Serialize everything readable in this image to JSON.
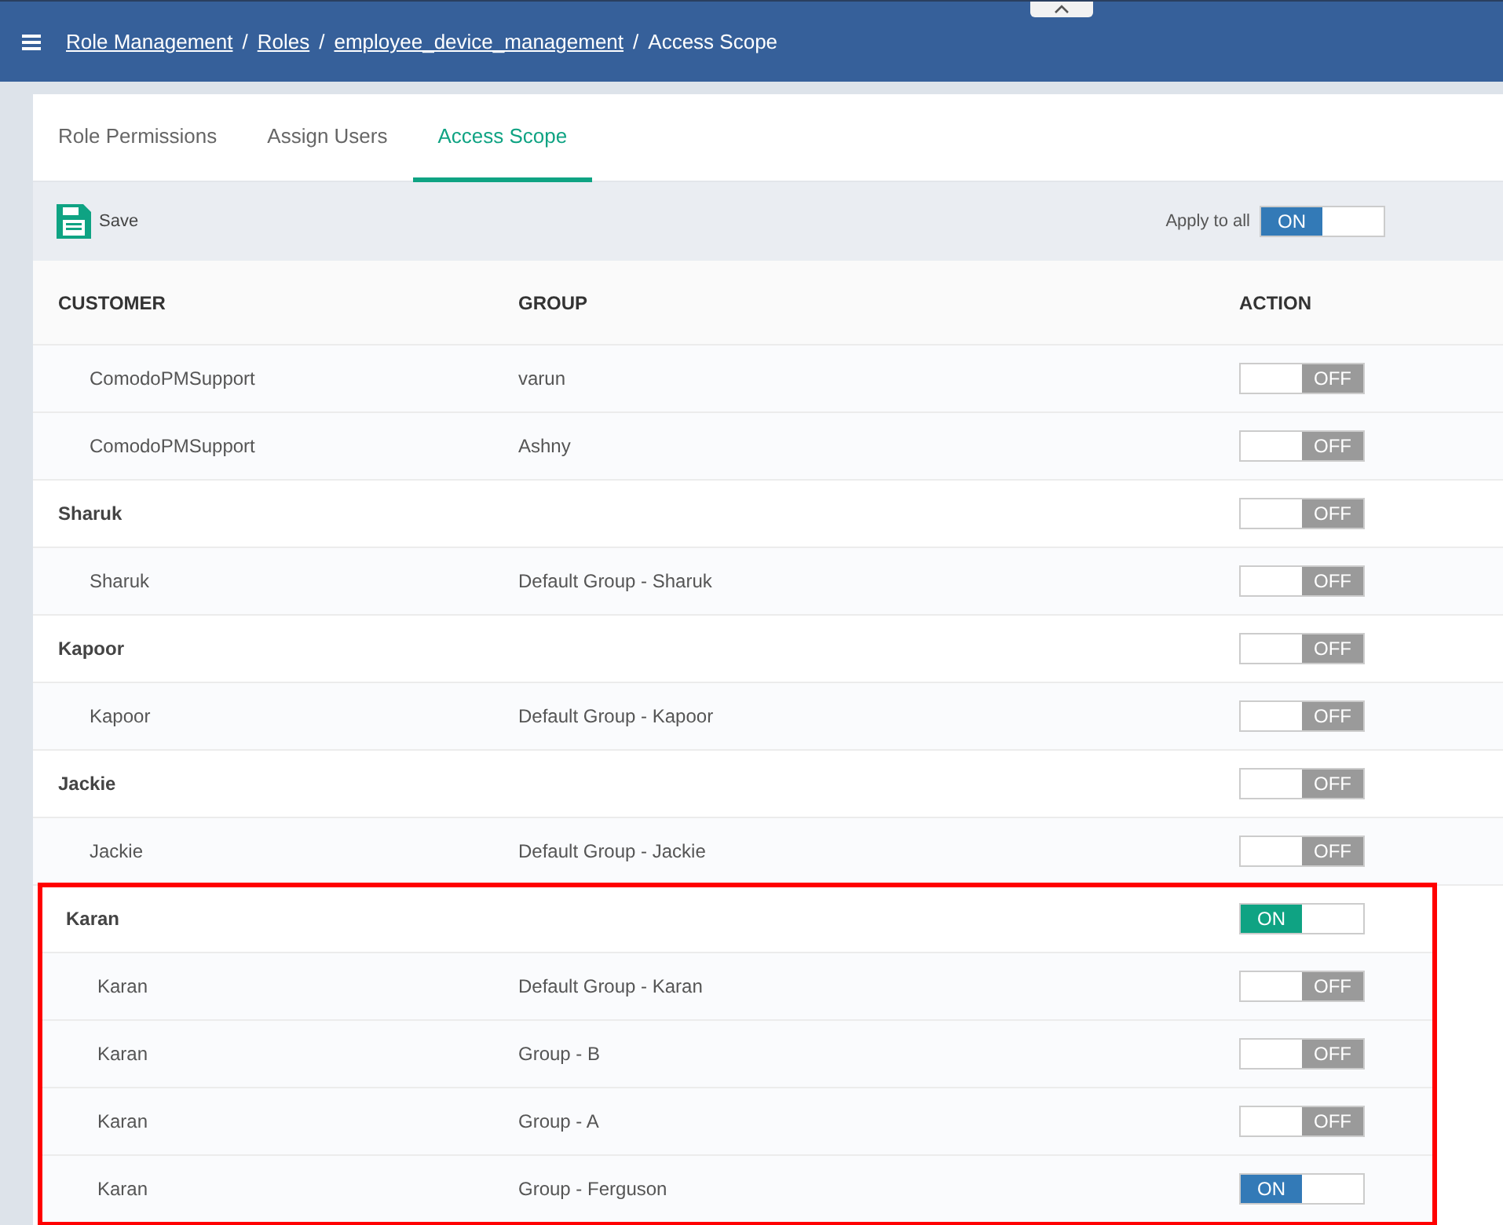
{
  "breadcrumb_separator": "/",
  "breadcrumb": [
    {
      "label": "Role Management",
      "link": true
    },
    {
      "label": "Roles",
      "link": true
    },
    {
      "label": "employee_device_management",
      "link": true
    },
    {
      "label": "Access Scope",
      "link": false
    }
  ],
  "tabs": [
    {
      "label": "Role Permissions",
      "selected": false
    },
    {
      "label": "Assign Users",
      "selected": false
    },
    {
      "label": "Access Scope",
      "selected": true
    }
  ],
  "toolbar": {
    "save_label": "Save",
    "apply_all_label": "Apply to all",
    "apply_all_toggle": {
      "on": true,
      "label": "ON",
      "color": "#337ab7"
    }
  },
  "table": {
    "columns": [
      "CUSTOMER",
      "GROUP",
      "ACTION"
    ],
    "sections": [
      {
        "highlighted": false,
        "rows": [
          {
            "kind": "child",
            "customer": "ComodoPMSupport",
            "group": "varun",
            "toggle": {
              "on": false,
              "label": "OFF"
            }
          },
          {
            "kind": "child",
            "customer": "ComodoPMSupport",
            "group": "Ashny",
            "toggle": {
              "on": false,
              "label": "OFF"
            }
          },
          {
            "kind": "parent",
            "customer": "Sharuk",
            "toggle": {
              "on": false,
              "label": "OFF"
            }
          },
          {
            "kind": "child",
            "customer": "Sharuk",
            "group": "Default Group - Sharuk",
            "toggle": {
              "on": false,
              "label": "OFF"
            }
          },
          {
            "kind": "parent",
            "customer": "Kapoor",
            "toggle": {
              "on": false,
              "label": "OFF"
            }
          },
          {
            "kind": "child",
            "customer": "Kapoor",
            "group": "Default Group - Kapoor",
            "toggle": {
              "on": false,
              "label": "OFF"
            }
          },
          {
            "kind": "parent",
            "customer": "Jackie",
            "toggle": {
              "on": false,
              "label": "OFF"
            }
          },
          {
            "kind": "child",
            "customer": "Jackie",
            "group": "Default Group - Jackie",
            "toggle": {
              "on": false,
              "label": "OFF"
            }
          }
        ]
      },
      {
        "highlighted": true,
        "rows": [
          {
            "kind": "parent",
            "customer": "Karan",
            "toggle": {
              "on": true,
              "label": "ON",
              "color": "#0fa383"
            }
          },
          {
            "kind": "child",
            "customer": "Karan",
            "group": "Default Group - Karan",
            "toggle": {
              "on": false,
              "label": "OFF"
            }
          },
          {
            "kind": "child",
            "customer": "Karan",
            "group": "Group - B",
            "toggle": {
              "on": false,
              "label": "OFF"
            }
          },
          {
            "kind": "child",
            "customer": "Karan",
            "group": "Group - A",
            "toggle": {
              "on": false,
              "label": "OFF"
            }
          },
          {
            "kind": "child",
            "customer": "Karan",
            "group": "Group - Ferguson",
            "toggle": {
              "on": true,
              "label": "ON",
              "color": "#337ab7"
            }
          }
        ]
      }
    ]
  }
}
